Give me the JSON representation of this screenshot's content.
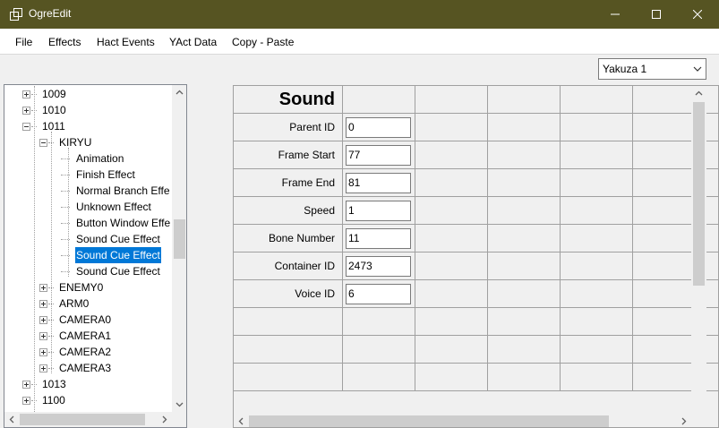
{
  "window": {
    "title": "OgreEdit"
  },
  "menu": {
    "items": [
      "File",
      "Effects",
      "Hact Events",
      "YAct Data",
      "Copy - Paste"
    ]
  },
  "game_select": {
    "value": "Yakuza 1"
  },
  "tree": {
    "rows": [
      {
        "label": "1009",
        "expander": "plus",
        "selected": false
      },
      {
        "label": "1010",
        "expander": "plus",
        "selected": false
      },
      {
        "label": "1011",
        "expander": "minus",
        "selected": false
      },
      {
        "label": "KIRYU",
        "expander": "minus",
        "selected": false
      },
      {
        "label": "Animation",
        "expander": "none",
        "selected": false
      },
      {
        "label": "Finish Effect",
        "expander": "none",
        "selected": false
      },
      {
        "label": "Normal Branch Effe",
        "expander": "none",
        "selected": false
      },
      {
        "label": "Unknown Effect",
        "expander": "none",
        "selected": false
      },
      {
        "label": "Button Window Effe",
        "expander": "none",
        "selected": false
      },
      {
        "label": "Sound Cue Effect",
        "expander": "none",
        "selected": false
      },
      {
        "label": "Sound Cue Effect",
        "expander": "none",
        "selected": true
      },
      {
        "label": "Sound Cue Effect",
        "expander": "none",
        "selected": false
      },
      {
        "label": "ENEMY0",
        "expander": "plus",
        "selected": false
      },
      {
        "label": "ARM0",
        "expander": "plus",
        "selected": false
      },
      {
        "label": "CAMERA0",
        "expander": "plus",
        "selected": false
      },
      {
        "label": "CAMERA1",
        "expander": "plus",
        "selected": false
      },
      {
        "label": "CAMERA2",
        "expander": "plus",
        "selected": false
      },
      {
        "label": "CAMERA3",
        "expander": "plus",
        "selected": false
      },
      {
        "label": "1013",
        "expander": "plus",
        "selected": false
      },
      {
        "label": "1100",
        "expander": "plus",
        "selected": false
      }
    ]
  },
  "grid": {
    "title": "Sound",
    "fields": [
      {
        "label": "Parent ID",
        "value": "0"
      },
      {
        "label": "Frame Start",
        "value": "77"
      },
      {
        "label": "Frame End",
        "value": "81"
      },
      {
        "label": "Speed",
        "value": "1"
      },
      {
        "label": "Bone Number",
        "value": "11"
      },
      {
        "label": "Container ID",
        "value": "2473"
      },
      {
        "label": "Voice ID",
        "value": "6"
      }
    ]
  },
  "icons": {
    "app": "app-window-icon",
    "minimize": "minimize-icon",
    "maximize": "maximize-icon",
    "close": "close-icon",
    "dropdown": "chevron-down-icon",
    "scroll": [
      "scroll-up-icon",
      "scroll-down-icon",
      "scroll-left-icon",
      "scroll-right-icon"
    ]
  },
  "colors": {
    "titlebar": "#565422",
    "selection": "#0078d7"
  }
}
